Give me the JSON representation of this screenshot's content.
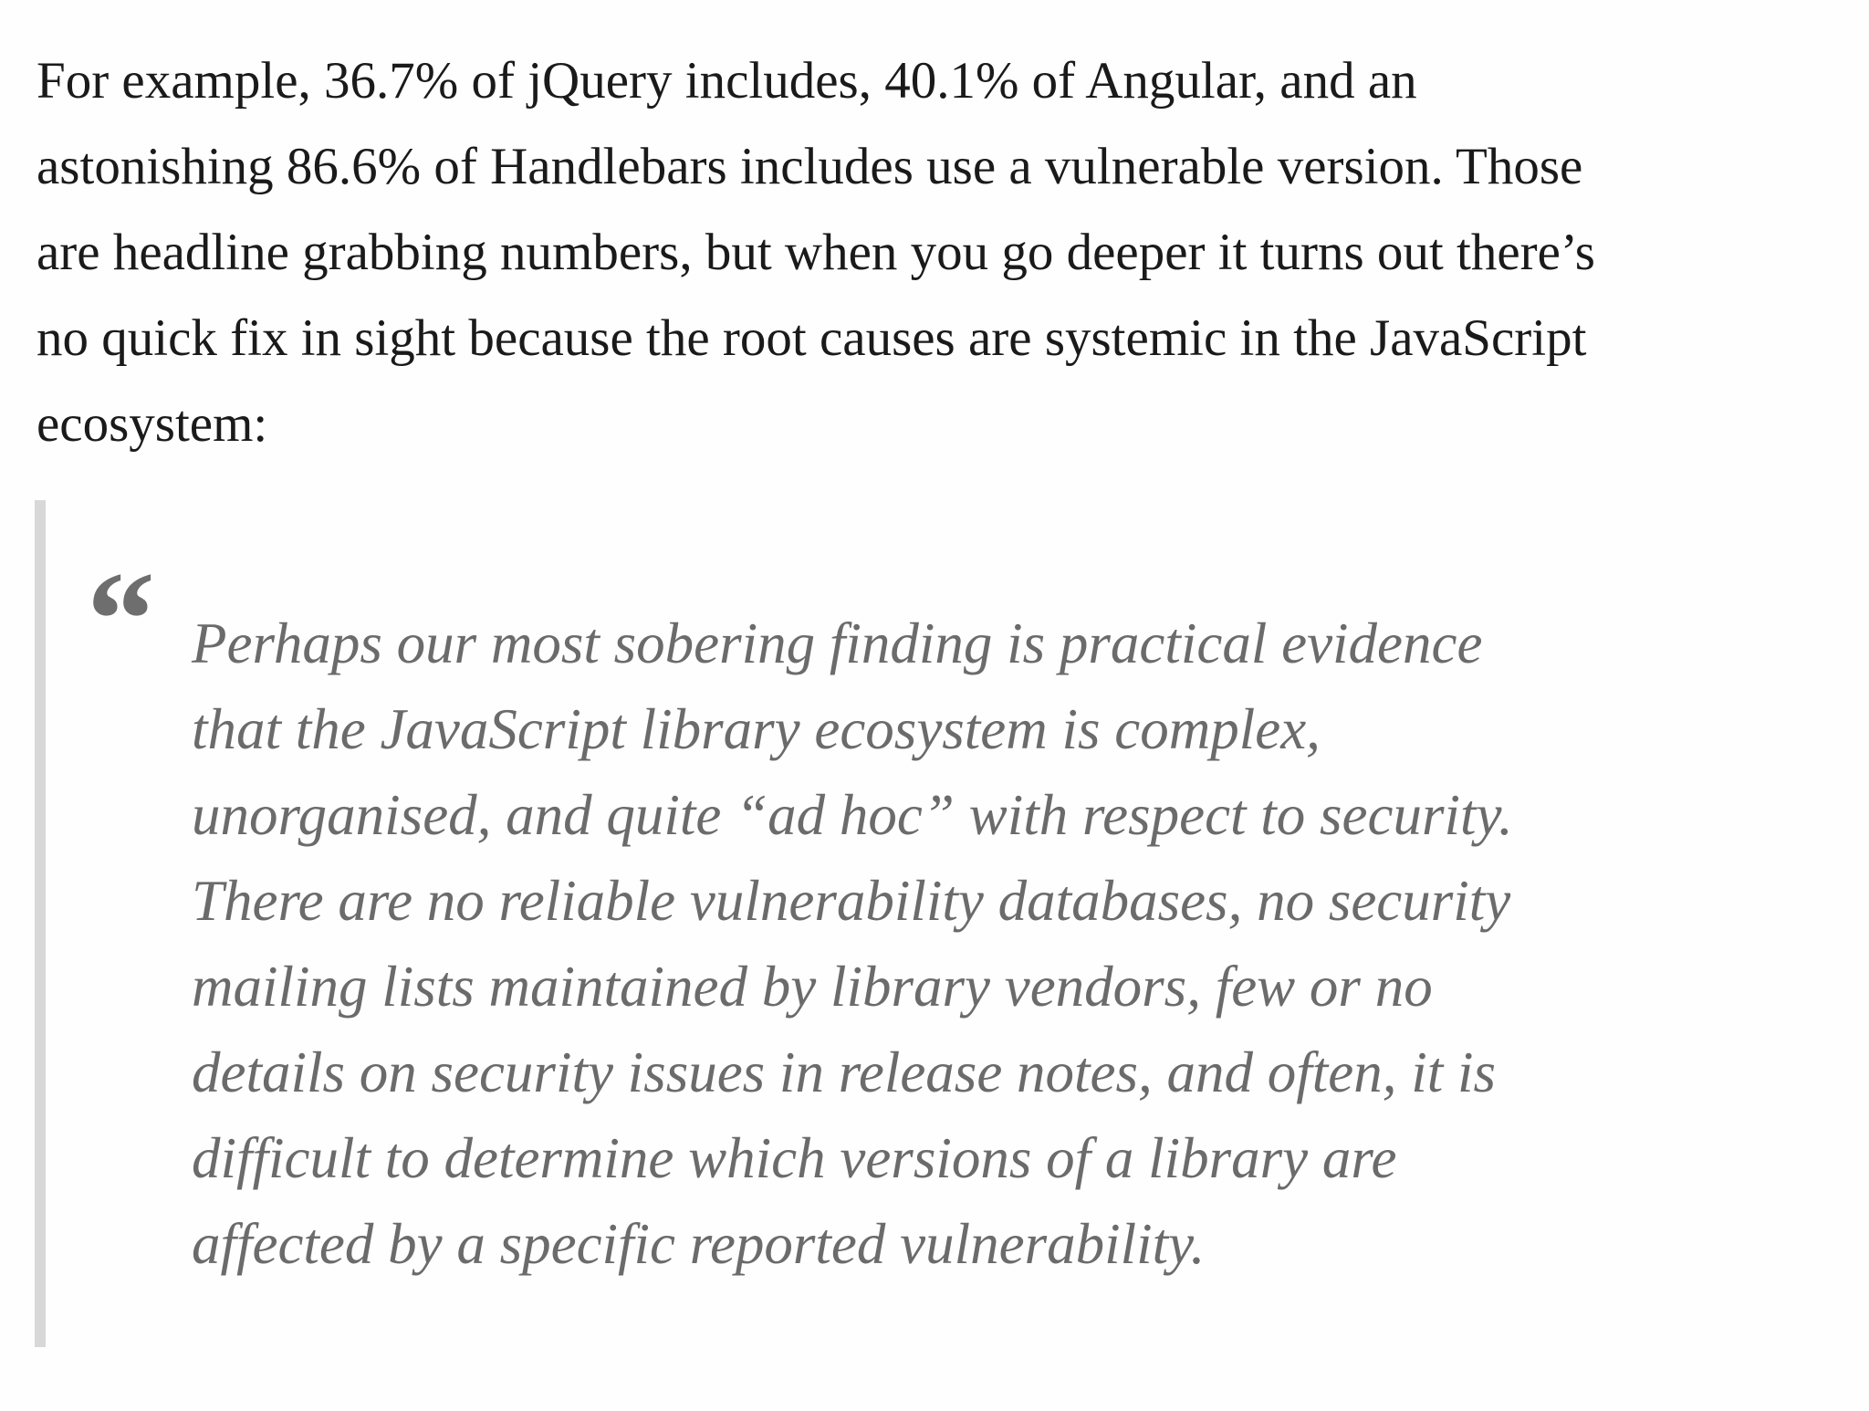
{
  "article": {
    "lead_paragraph": {
      "lines": [
        "For example, 36.7% of jQuery includes, 40.1% of Angular, and an",
        "astonishing 86.6% of Handlebars includes use a vulnerable version. Those",
        "are headline grabbing numbers, but when you go deeper it turns out there’s",
        "no quick fix in sight because the root causes are systemic in the JavaScript",
        "ecosystem:"
      ]
    },
    "blockquote": {
      "quote_mark": "“",
      "lines": [
        "Perhaps our most sobering finding is practical evidence",
        "that the JavaScript library ecosystem is complex,",
        "unorganised, and quite “ad hoc” with respect to security.",
        "There are no reliable vulnerability databases, no security",
        "mailing lists maintained by library vendors, few or no",
        "details on security issues in release notes, and often, it is",
        "difficult to determine which versions of a library are",
        "affected by a specific reported vulnerability."
      ]
    }
  }
}
